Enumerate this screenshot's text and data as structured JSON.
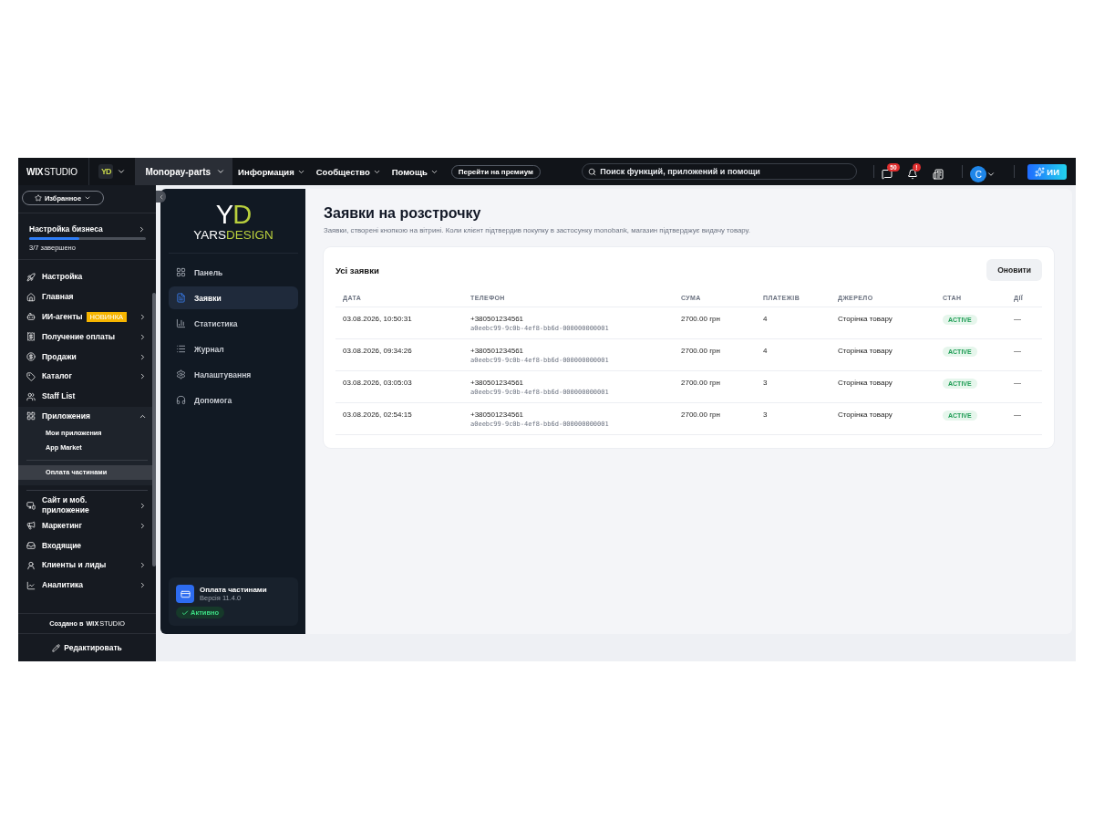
{
  "topbar": {
    "brand": {
      "bold": "WIX",
      "light": "STUDIO"
    },
    "site_logo": "YD",
    "site_name": "Monopay-parts",
    "menus": [
      "Информация",
      "Сообщество",
      "Помощь"
    ],
    "premium_button": "Перейти на премиум",
    "search": {
      "placeholder": "Поиск функций, приложений и помощи"
    },
    "messages_badge": "50",
    "notifications_badge": "!",
    "avatar": "C",
    "ai_button": "ИИ"
  },
  "sidebar": {
    "favorites": "Избранное",
    "setup": {
      "title": "Настройка бизнеса",
      "level": 0.43,
      "progress": "3/7 завершено"
    },
    "items": [
      {
        "label": "Настройка"
      },
      {
        "label": "Главная"
      },
      {
        "label": "ИИ-агенты",
        "badge": "НОВИНКА",
        "expanded": false
      },
      {
        "label": "Получение оплаты",
        "expanded": false
      },
      {
        "label": "Продажи",
        "expanded": false
      },
      {
        "label": "Каталог",
        "expanded": false
      },
      {
        "label": "Staff List"
      },
      {
        "label": "Приложения",
        "expanded": true,
        "children": [
          {
            "label": "Мои приложения",
            "selected": false
          },
          {
            "label": "App Market",
            "selected": false
          }
        ],
        "pinned": [
          {
            "label": "Оплата частинами",
            "selected": true
          }
        ]
      },
      {
        "label": "Сайт и моб. приложение",
        "expanded": false
      },
      {
        "label": "Маркетинг",
        "expanded": false
      },
      {
        "label": "Входящие"
      },
      {
        "label": "Клиенты и лиды",
        "expanded": false
      },
      {
        "label": "Аналитика",
        "expanded": false
      }
    ],
    "made_with": "Создано в",
    "made_with_brand": {
      "bold": "WIX",
      "light": "STUDIO"
    },
    "edit_button": "Редактировать"
  },
  "app": {
    "logo": {
      "mark_1": "Y",
      "mark_2": "D",
      "word_1": "YARS",
      "word_2": "DESIGN"
    },
    "nav": [
      {
        "label": "Панель",
        "selected": false
      },
      {
        "label": "Заявки",
        "selected": true
      },
      {
        "label": "Статистика",
        "selected": false
      },
      {
        "label": "Журнал",
        "selected": false
      },
      {
        "label": "Налаштування",
        "selected": false
      },
      {
        "label": "Допомога",
        "selected": false
      }
    ],
    "app_card": {
      "name": "Оплата частинами",
      "version": "Версія 11.4.0",
      "status": "Активно"
    },
    "title": "Заявки на розстрочку",
    "subtitle": "Заявки, створені кнопкою на вітрині. Коли клієнт підтвердив покупку в застосунку monobank, магазин підтверджує видачу товару.",
    "table": {
      "title": "Усі заявки",
      "refresh_button": "Оновити",
      "columns": [
        "ДАТА",
        "ТЕЛЕФОН",
        "СУМА",
        "ПЛАТЕЖІВ",
        "ДЖЕРЕЛО",
        "СТАН",
        "ДІЇ"
      ],
      "rows": [
        {
          "date": "03.08.2026, 10:50:31",
          "phone": "+380501234561",
          "id": "a0eebc99-9c0b-4ef8-bb6d-000000000001",
          "sum": "2700.00 грн",
          "payments": "4",
          "source": "Сторінка товару",
          "status": "ACTIVE",
          "actions": "—"
        },
        {
          "date": "03.08.2026, 09:34:26",
          "phone": "+380501234561",
          "id": "a0eebc99-9c0b-4ef8-bb6d-000000000001",
          "sum": "2700.00 грн",
          "payments": "4",
          "source": "Сторінка товару",
          "status": "ACTIVE",
          "actions": "—"
        },
        {
          "date": "03.08.2026, 03:05:03",
          "phone": "+380501234561",
          "id": "a0eebc99-9c0b-4ef8-bb6d-000000000001",
          "sum": "2700.00 грн",
          "payments": "3",
          "source": "Сторінка товару",
          "status": "ACTIVE",
          "actions": "—"
        },
        {
          "date": "03.08.2026, 02:54:15",
          "phone": "+380501234561",
          "id": "a0eebc99-9c0b-4ef8-bb6d-000000000001",
          "sum": "2700.00 грн",
          "payments": "3",
          "source": "Сторінка товару",
          "status": "ACTIVE",
          "actions": "—"
        }
      ]
    }
  }
}
